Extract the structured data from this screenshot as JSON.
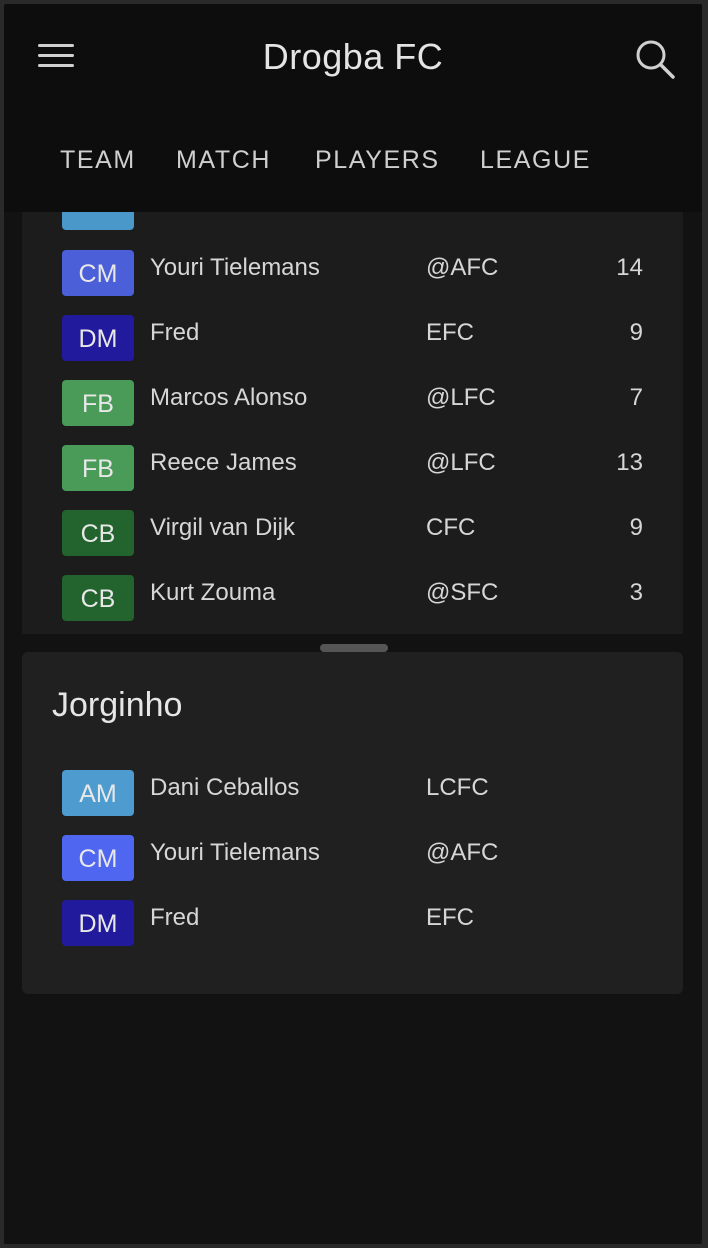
{
  "app": {
    "title": "Drogba FC"
  },
  "tabs": [
    {
      "label": "TEAM"
    },
    {
      "label": "MATCH"
    },
    {
      "label": "PLAYERS"
    },
    {
      "label": "LEAGUE"
    }
  ],
  "icons": {
    "menu": "menu-icon",
    "search": "search-icon"
  },
  "players": [
    {
      "pos": "CM",
      "color": "#4a5fd8",
      "name": "Youri Tielemans",
      "club": "@AFC",
      "num": "14"
    },
    {
      "pos": "DM",
      "color": "#221a9c",
      "name": "Fred",
      "club": "EFC",
      "num": "9"
    },
    {
      "pos": "FB",
      "color": "#4a9a58",
      "name": "Marcos Alonso",
      "club": "@LFC",
      "num": "7"
    },
    {
      "pos": "FB",
      "color": "#4a9a58",
      "name": "Reece James",
      "club": "@LFC",
      "num": "13"
    },
    {
      "pos": "CB",
      "color": "#23642e",
      "name": "Virgil van Dijk",
      "club": "CFC",
      "num": "9"
    },
    {
      "pos": "CB",
      "color": "#23642e",
      "name": "Kurt Zouma",
      "club": "@SFC",
      "num": "3"
    }
  ],
  "partial_top_badge_color": "#4a97c9",
  "sheet": {
    "title": "Jorginho",
    "players": [
      {
        "pos": "AM",
        "color": "#4e9ccf",
        "name": "Dani Ceballos",
        "club": "LCFC"
      },
      {
        "pos": "CM",
        "color": "#4f66f0",
        "name": "Youri Tielemans",
        "club": "@AFC"
      },
      {
        "pos": "DM",
        "color": "#221a9c",
        "name": "Fred",
        "club": "EFC"
      }
    ]
  }
}
